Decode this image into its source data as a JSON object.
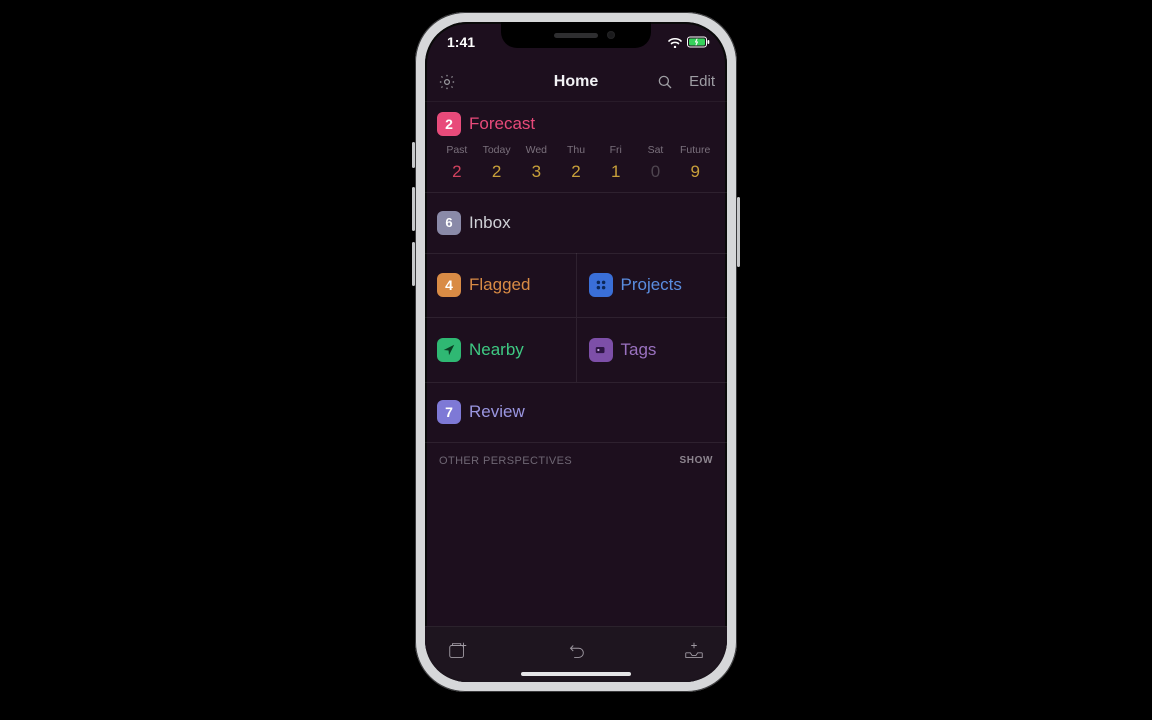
{
  "statusbar": {
    "time": "1:41"
  },
  "navbar": {
    "title": "Home",
    "edit_label": "Edit"
  },
  "forecast": {
    "badge": "2",
    "title": "Forecast",
    "days": [
      {
        "label": "Past",
        "count": "2",
        "tone": "red"
      },
      {
        "label": "Today",
        "count": "2",
        "tone": "yellow"
      },
      {
        "label": "Wed",
        "count": "3",
        "tone": "yellow"
      },
      {
        "label": "Thu",
        "count": "2",
        "tone": "yellow"
      },
      {
        "label": "Fri",
        "count": "1",
        "tone": "yellow"
      },
      {
        "label": "Sat",
        "count": "0",
        "tone": "dim"
      },
      {
        "label": "Future",
        "count": "9",
        "tone": "yellow"
      }
    ]
  },
  "inbox": {
    "badge": "6",
    "title": "Inbox"
  },
  "flagged": {
    "badge": "4",
    "title": "Flagged"
  },
  "projects": {
    "title": "Projects"
  },
  "nearby": {
    "title": "Nearby"
  },
  "tags": {
    "title": "Tags"
  },
  "review": {
    "badge": "7",
    "title": "Review"
  },
  "other_perspectives": {
    "label": "OTHER PERSPECTIVES",
    "show_label": "SHOW"
  }
}
